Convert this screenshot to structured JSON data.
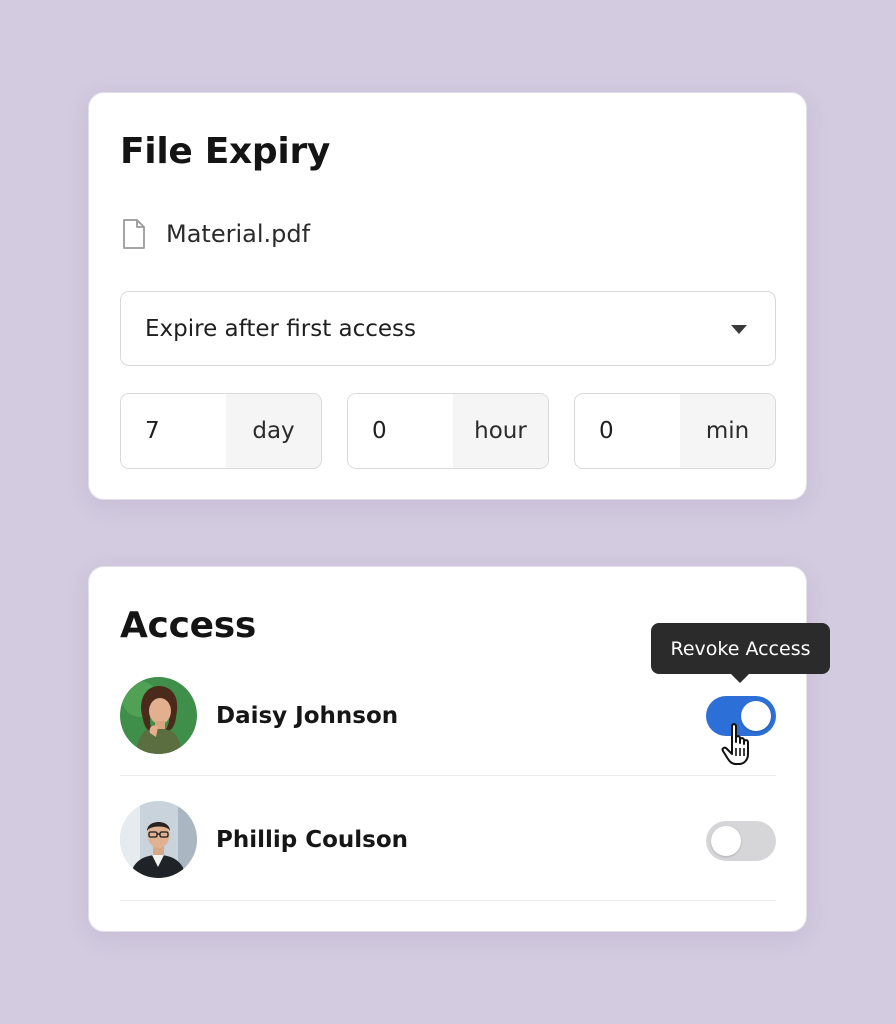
{
  "file_expiry": {
    "title": "File Expiry",
    "file": {
      "name": "Material.pdf",
      "icon": "file-icon"
    },
    "expiry_mode": {
      "selected": "Expire after first access",
      "icon": "caret-down-icon"
    },
    "duration": [
      {
        "value": "7",
        "unit": "day"
      },
      {
        "value": "0",
        "unit": "hour"
      },
      {
        "value": "0",
        "unit": "min"
      }
    ]
  },
  "access": {
    "title": "Access",
    "tooltip": "Revoke Access",
    "people": [
      {
        "name": "Daisy Johnson",
        "access_enabled": true
      },
      {
        "name": "Phillip Coulson",
        "access_enabled": false
      }
    ]
  },
  "colors": {
    "background": "#d3cbe0",
    "toggle_on": "#2c6fd6",
    "toggle_off": "#d6d6d8",
    "tooltip_bg": "#2b2b2b"
  }
}
